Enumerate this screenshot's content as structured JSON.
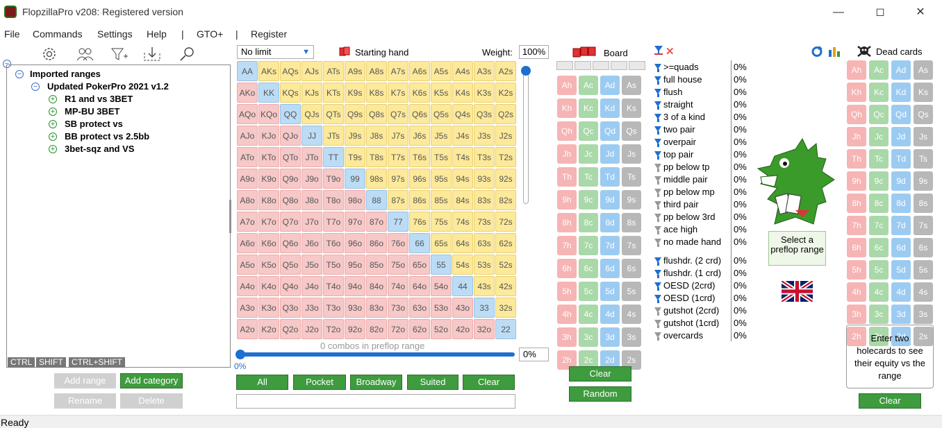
{
  "window": {
    "title": "FlopzillaPro v208: Registered version"
  },
  "menu": [
    "File",
    "Commands",
    "Settings",
    "Help",
    "|",
    "GTO+",
    "|",
    "Register"
  ],
  "tree": {
    "root": "Imported ranges",
    "group": "Updated PokerPro 2021 v1.2",
    "items": [
      "R1 and vs 3BET",
      "MP-BU 3BET",
      "SB protect vs",
      "BB protect vs 2.5bb",
      "3bet-sqz and VS"
    ]
  },
  "modkeys": [
    "CTRL",
    "SHIFT",
    "CTRL+SHIFT"
  ],
  "tree_buttons": {
    "add_range": "Add range",
    "add_category": "Add category",
    "rename": "Rename",
    "delete": "Delete"
  },
  "range": {
    "limit": "No limit",
    "starting_hand_label": "Starting hand",
    "weight_label": "Weight:",
    "weight": "100%",
    "combos_text": "0 combos in preflop range",
    "slider_left": "0%",
    "slider_right": "0%",
    "buttons": [
      "All",
      "Pocket",
      "Broadway",
      "Suited",
      "Clear"
    ],
    "ranks": [
      "A",
      "K",
      "Q",
      "J",
      "T",
      "9",
      "8",
      "7",
      "6",
      "5",
      "4",
      "3",
      "2"
    ]
  },
  "board": {
    "label": "Board",
    "clear": "Clear",
    "random": "Random"
  },
  "cards": {
    "ranks": [
      "A",
      "K",
      "Q",
      "J",
      "T",
      "9",
      "8",
      "7",
      "6",
      "5",
      "4",
      "3",
      "2"
    ],
    "suits": [
      "h",
      "c",
      "d",
      "s"
    ]
  },
  "stats": {
    "made": [
      {
        "label": ">=quads",
        "value": "0%",
        "on": true
      },
      {
        "label": "full house",
        "value": "0%",
        "on": true
      },
      {
        "label": "flush",
        "value": "0%",
        "on": true
      },
      {
        "label": "straight",
        "value": "0%",
        "on": true
      },
      {
        "label": "3 of a kind",
        "value": "0%",
        "on": true
      },
      {
        "label": "two pair",
        "value": "0%",
        "on": true
      },
      {
        "label": "overpair",
        "value": "0%",
        "on": true
      },
      {
        "label": "top pair",
        "value": "0%",
        "on": true
      },
      {
        "label": "pp below tp",
        "value": "0%",
        "on": false
      },
      {
        "label": "middle pair",
        "value": "0%",
        "on": false
      },
      {
        "label": "pp below mp",
        "value": "0%",
        "on": false
      },
      {
        "label": "third pair",
        "value": "0%",
        "on": false
      },
      {
        "label": "pp below 3rd",
        "value": "0%",
        "on": false
      },
      {
        "label": "ace high",
        "value": "0%",
        "on": false
      },
      {
        "label": "no made hand",
        "value": "0%",
        "on": false
      }
    ],
    "draws": [
      {
        "label": "flushdr. (2 crd)",
        "value": "0%",
        "on": true
      },
      {
        "label": "flushdr. (1 crd)",
        "value": "0%",
        "on": true
      },
      {
        "label": "OESD (2crd)",
        "value": "0%",
        "on": true
      },
      {
        "label": "OESD (1crd)",
        "value": "0%",
        "on": true
      },
      {
        "label": "gutshot (2crd)",
        "value": "0%",
        "on": false
      },
      {
        "label": "gutshot (1crd)",
        "value": "0%",
        "on": false
      },
      {
        "label": "overcards",
        "value": "0%",
        "on": false
      }
    ]
  },
  "mascot": {
    "select_text": "Select a preflop range"
  },
  "dead": {
    "label": "Dead cards",
    "info": "Enter two holecards to see their equity vs the range",
    "clear": "Clear"
  },
  "status": "Ready"
}
